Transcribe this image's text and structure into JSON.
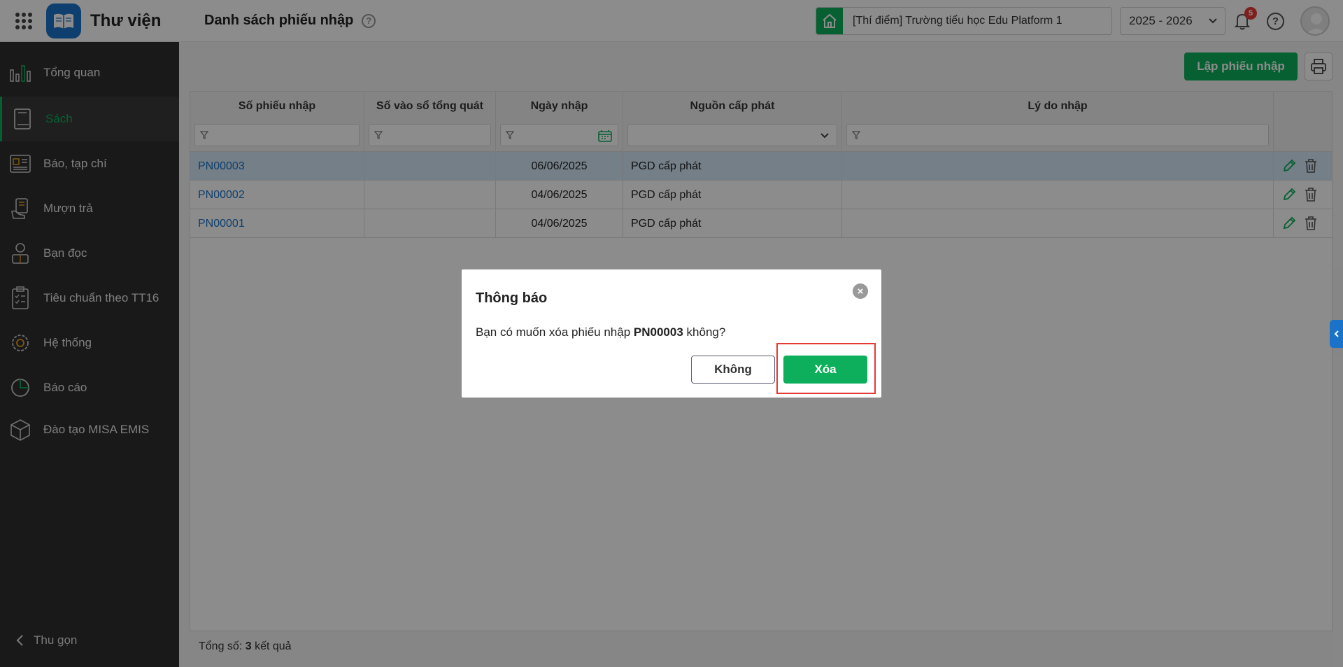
{
  "app": {
    "title": "Thư viện"
  },
  "header": {
    "page_title": "Danh sách phiếu nhập",
    "help_icon": "?",
    "school": "[Thí điểm] Trường tiểu học Edu Platform 1",
    "year": "2025 - 2026",
    "notification_count": "5",
    "help_label": "?"
  },
  "sidebar": {
    "items": [
      {
        "label": "Tổng quan",
        "icon": "bar-chart-icon"
      },
      {
        "label": "Sách",
        "icon": "book-icon"
      },
      {
        "label": "Báo, tạp chí",
        "icon": "newspaper-icon"
      },
      {
        "label": "Mượn trả",
        "icon": "borrow-icon"
      },
      {
        "label": "Bạn đọc",
        "icon": "reader-icon"
      },
      {
        "label": "Tiêu chuẩn theo TT16",
        "icon": "clipboard-icon"
      },
      {
        "label": "Hệ thống",
        "icon": "gear-icon"
      },
      {
        "label": "Báo cáo",
        "icon": "pie-chart-icon"
      },
      {
        "label": "Đào tạo MISA EMIS",
        "icon": "cube-icon"
      }
    ],
    "collapse_label": "Thu gọn"
  },
  "toolbar": {
    "create_label": "Lập phiếu nhập"
  },
  "table": {
    "columns": [
      "Số phiếu nhập",
      "Số vào sổ tổng quát",
      "Ngày nhập",
      "Nguồn cấp phát",
      "Lý do nhập"
    ],
    "rows": [
      {
        "code": "PN00003",
        "ledger": "",
        "date": "06/06/2025",
        "source": "PGD cấp phát",
        "reason": ""
      },
      {
        "code": "PN00002",
        "ledger": "",
        "date": "04/06/2025",
        "source": "PGD cấp phát",
        "reason": ""
      },
      {
        "code": "PN00001",
        "ledger": "",
        "date": "04/06/2025",
        "source": "PGD cấp phát",
        "reason": ""
      }
    ]
  },
  "footer": {
    "prefix": "Tổng số:",
    "count": "3",
    "suffix": "kết quả"
  },
  "dialog": {
    "title": "Thông báo",
    "close": "×",
    "message_prefix": "Bạn có muốn xóa phiếu nhập",
    "message_code": "PN00003",
    "message_suffix": "không?",
    "cancel_label": "Không",
    "confirm_label": "Xóa"
  },
  "colors": {
    "accent": "#0eaf5c",
    "link": "#1a73c9",
    "sidebar_bg": "#2e2e2e",
    "highlight": "#e53935"
  }
}
